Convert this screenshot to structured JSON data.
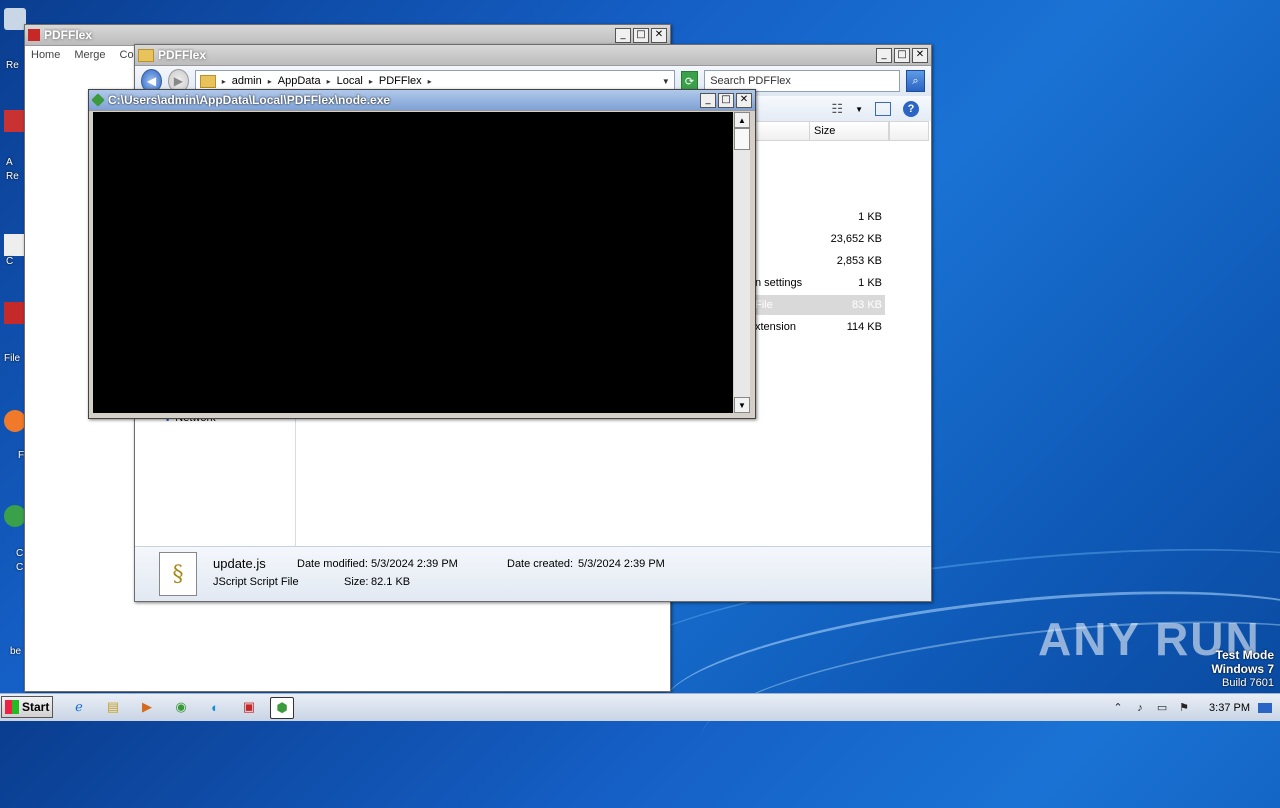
{
  "desktop": {
    "labels": [
      "Re",
      "A",
      "Re",
      "C",
      "File",
      "F",
      "C",
      "C",
      "be"
    ]
  },
  "pdfflex_app": {
    "title": "PDFFlex",
    "menu": [
      "Home",
      "Merge",
      "Com"
    ]
  },
  "explorer": {
    "title": "PDFFlex",
    "breadcrumb": [
      "admin",
      "AppData",
      "Local",
      "PDFFlex"
    ],
    "search_placeholder": "Search PDFFlex",
    "columns": {
      "size": "Size"
    },
    "files": [
      {
        "name": "",
        "size": "1 KB",
        "selected": false
      },
      {
        "name": "",
        "size": "23,652 KB",
        "selected": false
      },
      {
        "name": "",
        "size": "2,853 KB",
        "selected": false
      },
      {
        "name": "n settings",
        "size": "1 KB",
        "selected": false
      },
      {
        "name": "File",
        "size": "83 KB",
        "selected": true
      },
      {
        "name": "xtension",
        "size": "114 KB",
        "selected": false
      }
    ],
    "nav_item": "Network",
    "details": {
      "filename": "update.js",
      "filetype": "JScript Script File",
      "date_modified_label": "Date modified:",
      "date_modified": "5/3/2024 2:39 PM",
      "size_label": "Size:",
      "size": "82.1 KB",
      "date_created_label": "Date created:",
      "date_created": "5/3/2024 2:39 PM"
    }
  },
  "console": {
    "title": "C:\\Users\\admin\\AppData\\Local\\PDFFlex\\node.exe"
  },
  "taskbar": {
    "start_label": "Start",
    "clock": "3:37 PM"
  },
  "watermark": "ANY RUN",
  "test_mode": {
    "line1": "Test Mode",
    "line2": "Windows 7",
    "line3": "Build 7601"
  }
}
